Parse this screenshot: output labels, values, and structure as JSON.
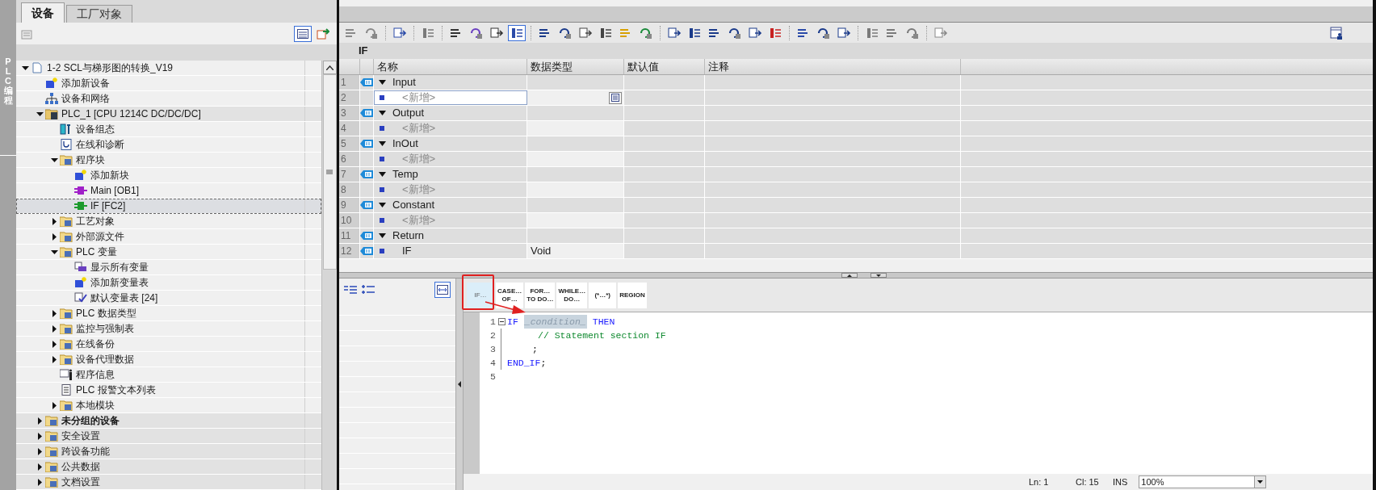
{
  "side_strip": {
    "label": "PLC 编程"
  },
  "project_tabs": [
    {
      "label": "设备",
      "selected": true
    },
    {
      "label": "工厂对象",
      "selected": false
    }
  ],
  "tree": [
    {
      "label": "1-2 SCL与梯形图的转换_V19",
      "kind": "project",
      "expanded": true,
      "selected": false,
      "children": [
        {
          "label": "添加新设备",
          "kind": "add",
          "selected": false
        },
        {
          "label": "设备和网络",
          "kind": "network",
          "selected": false
        },
        {
          "label": "PLC_1 [CPU 1214C DC/DC/DC]",
          "kind": "plc",
          "expanded": true,
          "selected": false,
          "children": [
            {
              "label": "设备组态",
              "kind": "config",
              "selected": false
            },
            {
              "label": "在线和诊断",
              "kind": "diag",
              "selected": false
            },
            {
              "label": "程序块",
              "kind": "folder",
              "expanded": true,
              "selected": false,
              "children": [
                {
                  "label": "添加新块",
                  "kind": "add",
                  "selected": false
                },
                {
                  "label": "Main [OB1]",
                  "kind": "ob",
                  "selected": false
                },
                {
                  "label": "IF [FC2]",
                  "kind": "fc",
                  "selected": true
                }
              ]
            },
            {
              "label": "工艺对象",
              "kind": "folder",
              "expanded": false,
              "selected": false
            },
            {
              "label": "外部源文件",
              "kind": "folder",
              "expanded": false,
              "selected": false
            },
            {
              "label": "PLC 变量",
              "kind": "folder",
              "expanded": true,
              "selected": false,
              "children": [
                {
                  "label": "显示所有变量",
                  "kind": "tags",
                  "selected": false
                },
                {
                  "label": "添加新变量表",
                  "kind": "add",
                  "selected": false
                },
                {
                  "label": "默认变量表 [24]",
                  "kind": "tagtable",
                  "selected": false
                }
              ]
            },
            {
              "label": "PLC 数据类型",
              "kind": "folder",
              "expanded": false,
              "selected": false
            },
            {
              "label": "监控与强制表",
              "kind": "folder",
              "expanded": false,
              "selected": false
            },
            {
              "label": "在线备份",
              "kind": "folder",
              "expanded": false,
              "selected": false
            },
            {
              "label": "设备代理数据",
              "kind": "folder",
              "expanded": false,
              "selected": false
            },
            {
              "label": "程序信息",
              "kind": "info",
              "selected": false
            },
            {
              "label": "PLC 报警文本列表",
              "kind": "doc",
              "selected": false
            },
            {
              "label": "本地模块",
              "kind": "folder",
              "expanded": false,
              "selected": false
            }
          ]
        },
        {
          "label": "未分组的设备",
          "kind": "folder",
          "expanded": false,
          "selected": false,
          "bold": true
        },
        {
          "label": "安全设置",
          "kind": "folder",
          "expanded": false,
          "selected": false
        },
        {
          "label": "跨设备功能",
          "kind": "folder",
          "expanded": false,
          "selected": false
        },
        {
          "label": "公共数据",
          "kind": "folder",
          "expanded": false,
          "selected": false
        },
        {
          "label": "文档设置",
          "kind": "folder",
          "expanded": false,
          "selected": false
        }
      ]
    }
  ],
  "editor_toolbar": [
    {
      "kind": "button",
      "pressed": false
    },
    {
      "kind": "button",
      "pressed": false
    },
    {
      "kind": "separator"
    },
    {
      "kind": "button",
      "pressed": false
    },
    {
      "kind": "separator"
    },
    {
      "kind": "button",
      "pressed": false
    },
    {
      "kind": "separator"
    },
    {
      "kind": "button",
      "pressed": false
    },
    {
      "kind": "button",
      "pressed": false
    },
    {
      "kind": "button",
      "pressed": false
    },
    {
      "kind": "button",
      "pressed": true
    },
    {
      "kind": "separator"
    },
    {
      "kind": "button",
      "pressed": false
    },
    {
      "kind": "button",
      "pressed": false
    },
    {
      "kind": "button",
      "pressed": false
    },
    {
      "kind": "button",
      "pressed": false
    },
    {
      "kind": "button",
      "pressed": false
    },
    {
      "kind": "button",
      "pressed": false
    },
    {
      "kind": "separator"
    },
    {
      "kind": "button",
      "pressed": false
    },
    {
      "kind": "button",
      "pressed": false
    },
    {
      "kind": "button",
      "pressed": false
    },
    {
      "kind": "button",
      "pressed": false
    },
    {
      "kind": "button",
      "pressed": false
    },
    {
      "kind": "button",
      "pressed": false
    },
    {
      "kind": "separator"
    },
    {
      "kind": "button",
      "pressed": false
    },
    {
      "kind": "button",
      "pressed": false
    },
    {
      "kind": "button",
      "pressed": false
    },
    {
      "kind": "separator"
    },
    {
      "kind": "button",
      "pressed": false
    },
    {
      "kind": "button",
      "pressed": false
    },
    {
      "kind": "button",
      "pressed": false
    },
    {
      "kind": "separator"
    },
    {
      "kind": "button",
      "pressed": false
    }
  ],
  "block_title": "IF",
  "interface_table": {
    "columns": [
      "名称",
      "数据类型",
      "默认值",
      "注释"
    ],
    "rows": [
      {
        "num": "1",
        "kind": "section",
        "name": "Input",
        "type": "",
        "selected": false
      },
      {
        "num": "2",
        "kind": "placeholder",
        "name": "<新增>",
        "type": "",
        "selected": true
      },
      {
        "num": "3",
        "kind": "section",
        "name": "Output",
        "type": "",
        "selected": false
      },
      {
        "num": "4",
        "kind": "placeholder",
        "name": "<新增>",
        "type": "",
        "selected": false
      },
      {
        "num": "5",
        "kind": "section",
        "name": "InOut",
        "type": "",
        "selected": false
      },
      {
        "num": "6",
        "kind": "placeholder",
        "name": "<新增>",
        "type": "",
        "selected": false
      },
      {
        "num": "7",
        "kind": "section",
        "name": "Temp",
        "type": "",
        "selected": false
      },
      {
        "num": "8",
        "kind": "placeholder",
        "name": "<新增>",
        "type": "",
        "selected": false
      },
      {
        "num": "9",
        "kind": "section",
        "name": "Constant",
        "type": "",
        "selected": false
      },
      {
        "num": "10",
        "kind": "placeholder",
        "name": "<新增>",
        "type": "",
        "selected": false
      },
      {
        "num": "11",
        "kind": "section",
        "name": "Return",
        "type": "",
        "selected": false
      },
      {
        "num": "12",
        "kind": "variable",
        "name": "IF",
        "type": "Void",
        "selected": false
      }
    ]
  },
  "snippets": [
    {
      "lines": [
        "IF…"
      ],
      "selected": true
    },
    {
      "lines": [
        "CASE…",
        "OF…"
      ],
      "selected": false
    },
    {
      "lines": [
        "FOR…",
        "TO DO…"
      ],
      "selected": false
    },
    {
      "lines": [
        "WHILE…",
        "DO…"
      ],
      "selected": false
    },
    {
      "lines": [
        "(*…*)"
      ],
      "selected": false
    },
    {
      "lines": [
        "REGION"
      ],
      "selected": false
    }
  ],
  "code": [
    {
      "num": "1",
      "fold": true,
      "indent": false,
      "tokens": [
        {
          "kind": "keyword",
          "text": "IF"
        },
        {
          "kind": "placeholder",
          "text": "_condition_"
        },
        {
          "kind": "keyword",
          "text": "THEN"
        }
      ]
    },
    {
      "num": "2",
      "fold": false,
      "indent": true,
      "tokens": [
        {
          "kind": "comment",
          "text": "// Statement section IF"
        }
      ]
    },
    {
      "num": "3",
      "fold": false,
      "indent": true,
      "tokens": [
        {
          "kind": "plain",
          "text": ";"
        }
      ]
    },
    {
      "num": "4",
      "fold": false,
      "indent": false,
      "tokens": [
        {
          "kind": "keyword",
          "text": "END_IF"
        },
        {
          "kind": "plain",
          "text": ";"
        }
      ]
    },
    {
      "num": "5",
      "fold": false
    }
  ],
  "status_bar": {
    "line": "Ln: 1",
    "column": "Cl: 15",
    "mode": "INS",
    "zoom": "100%"
  }
}
